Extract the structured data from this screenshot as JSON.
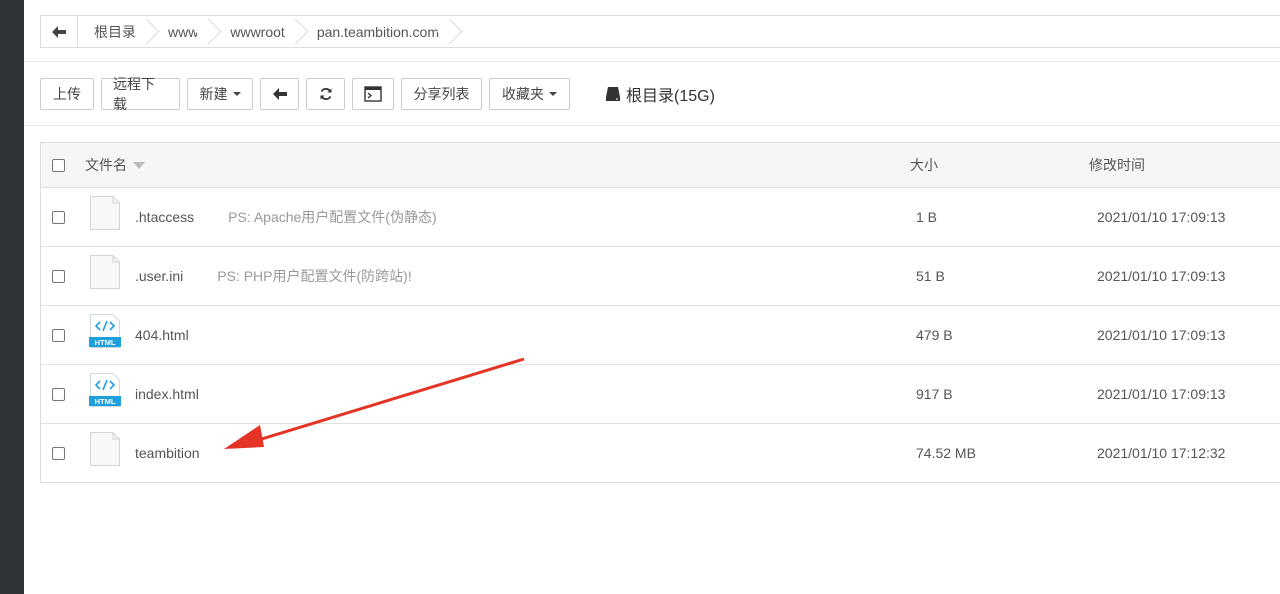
{
  "breadcrumb": {
    "items": [
      "根目录",
      "www",
      "wwwroot",
      "pan.teambition.com"
    ]
  },
  "toolbar": {
    "upload": "上传",
    "remote_download": "远程下载",
    "new": "新建",
    "share_list": "分享列表",
    "favorites": "收藏夹",
    "disk_label": "根目录(15G)"
  },
  "table": {
    "headers": {
      "name": "文件名",
      "size": "大小",
      "modified": "修改时间"
    },
    "rows": [
      {
        "name": ".htaccess",
        "note": "PS: Apache用户配置文件(伪静态)",
        "size": "1 B",
        "modified": "2021/01/10 17:09:13",
        "icon": "file-icon"
      },
      {
        "name": ".user.ini",
        "note": "PS: PHP用户配置文件(防跨站)!",
        "size": "51 B",
        "modified": "2021/01/10 17:09:13",
        "icon": "file-icon"
      },
      {
        "name": "404.html",
        "note": "",
        "size": "479 B",
        "modified": "2021/01/10 17:09:13",
        "icon": "html-file-icon"
      },
      {
        "name": "index.html",
        "note": "",
        "size": "917 B",
        "modified": "2021/01/10 17:09:13",
        "icon": "html-file-icon"
      },
      {
        "name": "teambition",
        "note": "",
        "size": "74.52 MB",
        "modified": "2021/01/10 17:12:32",
        "icon": "file-icon"
      }
    ]
  },
  "annotation": {
    "arrow_color": "#e53425"
  },
  "colors": {
    "html_icon": "#1e9fde",
    "border": "#dddddd",
    "header_bg": "#f6f6f6"
  }
}
